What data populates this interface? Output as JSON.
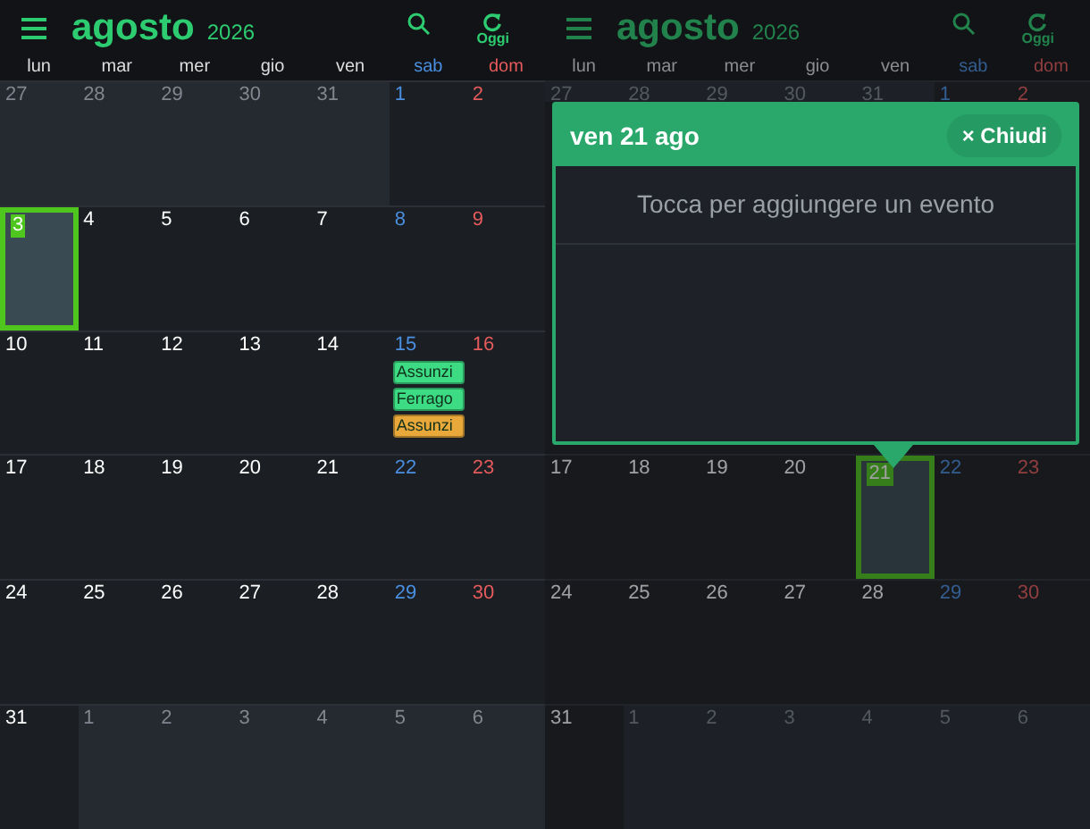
{
  "left_screen": {
    "header": {
      "month": "agosto",
      "year": "2026",
      "today_button": "Oggi"
    },
    "weekdays": [
      "lun",
      "mar",
      "mer",
      "gio",
      "ven",
      "sab",
      "dom"
    ],
    "weeks": [
      {
        "days": [
          {
            "n": "27",
            "in_month": false,
            "selected": false
          },
          {
            "n": "28",
            "in_month": false,
            "selected": false
          },
          {
            "n": "29",
            "in_month": false,
            "selected": false
          },
          {
            "n": "30",
            "in_month": false,
            "selected": false
          },
          {
            "n": "31",
            "in_month": false,
            "selected": false
          },
          {
            "n": "1",
            "in_month": true,
            "selected": false
          },
          {
            "n": "2",
            "in_month": true,
            "selected": false
          }
        ]
      },
      {
        "days": [
          {
            "n": "3",
            "in_month": true,
            "selected": true
          },
          {
            "n": "4",
            "in_month": true,
            "selected": false
          },
          {
            "n": "5",
            "in_month": true,
            "selected": false
          },
          {
            "n": "6",
            "in_month": true,
            "selected": false
          },
          {
            "n": "7",
            "in_month": true,
            "selected": false
          },
          {
            "n": "8",
            "in_month": true,
            "selected": false
          },
          {
            "n": "9",
            "in_month": true,
            "selected": false
          }
        ]
      },
      {
        "days": [
          {
            "n": "10",
            "in_month": true,
            "selected": false
          },
          {
            "n": "11",
            "in_month": true,
            "selected": false
          },
          {
            "n": "12",
            "in_month": true,
            "selected": false
          },
          {
            "n": "13",
            "in_month": true,
            "selected": false
          },
          {
            "n": "14",
            "in_month": true,
            "selected": false
          },
          {
            "n": "15",
            "in_month": true,
            "selected": false,
            "events": [
              {
                "label": "Assunzi",
                "color": "#3ddc84"
              },
              {
                "label": "Ferrago",
                "color": "#3ddc84"
              },
              {
                "label": "Assunzi",
                "color": "#e8a93a"
              }
            ]
          },
          {
            "n": "16",
            "in_month": true,
            "selected": false
          }
        ]
      },
      {
        "days": [
          {
            "n": "17",
            "in_month": true,
            "selected": false
          },
          {
            "n": "18",
            "in_month": true,
            "selected": false
          },
          {
            "n": "19",
            "in_month": true,
            "selected": false
          },
          {
            "n": "20",
            "in_month": true,
            "selected": false
          },
          {
            "n": "21",
            "in_month": true,
            "selected": false
          },
          {
            "n": "22",
            "in_month": true,
            "selected": false
          },
          {
            "n": "23",
            "in_month": true,
            "selected": false
          }
        ]
      },
      {
        "days": [
          {
            "n": "24",
            "in_month": true,
            "selected": false
          },
          {
            "n": "25",
            "in_month": true,
            "selected": false
          },
          {
            "n": "26",
            "in_month": true,
            "selected": false
          },
          {
            "n": "27",
            "in_month": true,
            "selected": false
          },
          {
            "n": "28",
            "in_month": true,
            "selected": false
          },
          {
            "n": "29",
            "in_month": true,
            "selected": false
          },
          {
            "n": "30",
            "in_month": true,
            "selected": false
          }
        ]
      },
      {
        "days": [
          {
            "n": "31",
            "in_month": true,
            "selected": false
          },
          {
            "n": "1",
            "in_month": false,
            "selected": false
          },
          {
            "n": "2",
            "in_month": false,
            "selected": false
          },
          {
            "n": "3",
            "in_month": false,
            "selected": false
          },
          {
            "n": "4",
            "in_month": false,
            "selected": false
          },
          {
            "n": "5",
            "in_month": false,
            "selected": false
          },
          {
            "n": "6",
            "in_month": false,
            "selected": false
          }
        ]
      }
    ]
  },
  "right_screen": {
    "header": {
      "month": "agosto",
      "year": "2026",
      "today_button": "Oggi"
    },
    "weekdays": [
      "lun",
      "mar",
      "mer",
      "gio",
      "ven",
      "sab",
      "dom"
    ],
    "top_weeks": [
      {
        "days": [
          {
            "n": "27",
            "in_month": false,
            "selected": false
          },
          {
            "n": "28",
            "in_month": false,
            "selected": false
          },
          {
            "n": "29",
            "in_month": false,
            "selected": false
          },
          {
            "n": "30",
            "in_month": false,
            "selected": false
          },
          {
            "n": "31",
            "in_month": false,
            "selected": false
          },
          {
            "n": "1",
            "in_month": true,
            "selected": false
          },
          {
            "n": "2",
            "in_month": true,
            "selected": false
          }
        ]
      }
    ],
    "bottom_weeks": [
      {
        "days": [
          {
            "n": "17",
            "in_month": true,
            "selected": false
          },
          {
            "n": "18",
            "in_month": true,
            "selected": false
          },
          {
            "n": "19",
            "in_month": true,
            "selected": false
          },
          {
            "n": "20",
            "in_month": true,
            "selected": false
          },
          {
            "n": "21",
            "in_month": true,
            "selected": true
          },
          {
            "n": "22",
            "in_month": true,
            "selected": false
          },
          {
            "n": "23",
            "in_month": true,
            "selected": false
          }
        ]
      },
      {
        "days": [
          {
            "n": "24",
            "in_month": true,
            "selected": false
          },
          {
            "n": "25",
            "in_month": true,
            "selected": false
          },
          {
            "n": "26",
            "in_month": true,
            "selected": false
          },
          {
            "n": "27",
            "in_month": true,
            "selected": false
          },
          {
            "n": "28",
            "in_month": true,
            "selected": false
          },
          {
            "n": "29",
            "in_month": true,
            "selected": false
          },
          {
            "n": "30",
            "in_month": true,
            "selected": false
          }
        ]
      },
      {
        "days": [
          {
            "n": "31",
            "in_month": true,
            "selected": false
          },
          {
            "n": "1",
            "in_month": false,
            "selected": false
          },
          {
            "n": "2",
            "in_month": false,
            "selected": false
          },
          {
            "n": "3",
            "in_month": false,
            "selected": false
          },
          {
            "n": "4",
            "in_month": false,
            "selected": false
          },
          {
            "n": "5",
            "in_month": false,
            "selected": false
          },
          {
            "n": "6",
            "in_month": false,
            "selected": false
          }
        ]
      }
    ],
    "popup": {
      "title": "ven 21 ago",
      "close_button": "× Chiudi",
      "hint": "Tocca per aggiungere un evento"
    }
  }
}
